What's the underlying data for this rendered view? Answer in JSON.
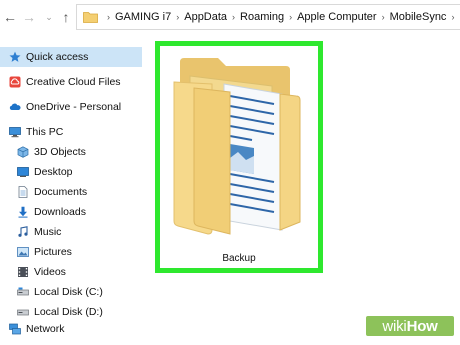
{
  "nav": {
    "back_glyph": "←",
    "forward_glyph": "→",
    "recent_glyph": "⌄",
    "up_glyph": "↑"
  },
  "address": {
    "separator": "›",
    "breadcrumbs": [
      "GAMING i7",
      "AppData",
      "Roaming",
      "Apple Computer",
      "MobileSync"
    ]
  },
  "sidebar": {
    "items": [
      {
        "label": "Quick access",
        "icon": "star-icon",
        "selected": true
      },
      {
        "label": "Creative Cloud Files",
        "icon": "creative-cloud-icon"
      },
      {
        "label": "OneDrive - Personal",
        "icon": "cloud-icon"
      },
      {
        "label": "This PC",
        "icon": "computer-icon"
      },
      {
        "label": "3D Objects",
        "icon": "cube-icon"
      },
      {
        "label": "Desktop",
        "icon": "desktop-icon"
      },
      {
        "label": "Documents",
        "icon": "document-icon"
      },
      {
        "label": "Downloads",
        "icon": "download-icon"
      },
      {
        "label": "Music",
        "icon": "music-icon"
      },
      {
        "label": "Pictures",
        "icon": "pictures-icon"
      },
      {
        "label": "Videos",
        "icon": "video-icon"
      },
      {
        "label": "Local Disk (C:)",
        "icon": "drive-icon"
      },
      {
        "label": "Local Disk (D:)",
        "icon": "drive-icon"
      },
      {
        "label": "Network",
        "icon": "network-icon"
      }
    ]
  },
  "content": {
    "folder": {
      "name": "Backup",
      "icon": "folder-icon"
    }
  },
  "watermark": {
    "wiki": "wiki",
    "how": "How"
  },
  "colors": {
    "highlight_border": "#2ee82e",
    "selection": "#cce4f7",
    "folder_yellow": "#f5d889",
    "watermark_green": "#8dc25a"
  }
}
